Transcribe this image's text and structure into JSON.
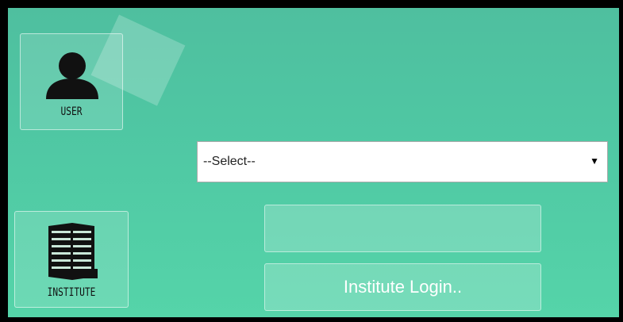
{
  "tiles": {
    "user": {
      "label": "USER",
      "icon": "user-icon"
    },
    "institute": {
      "label": "INSTITUTE",
      "icon": "building-icon"
    }
  },
  "form": {
    "select_value": "--Select--",
    "select_arrow": "▼",
    "input_value": "",
    "login_button_label": "Institute Login.."
  },
  "colors": {
    "panel_top": "#4fbf9f",
    "panel_bottom": "#55d4a9",
    "frame": "#000000"
  }
}
